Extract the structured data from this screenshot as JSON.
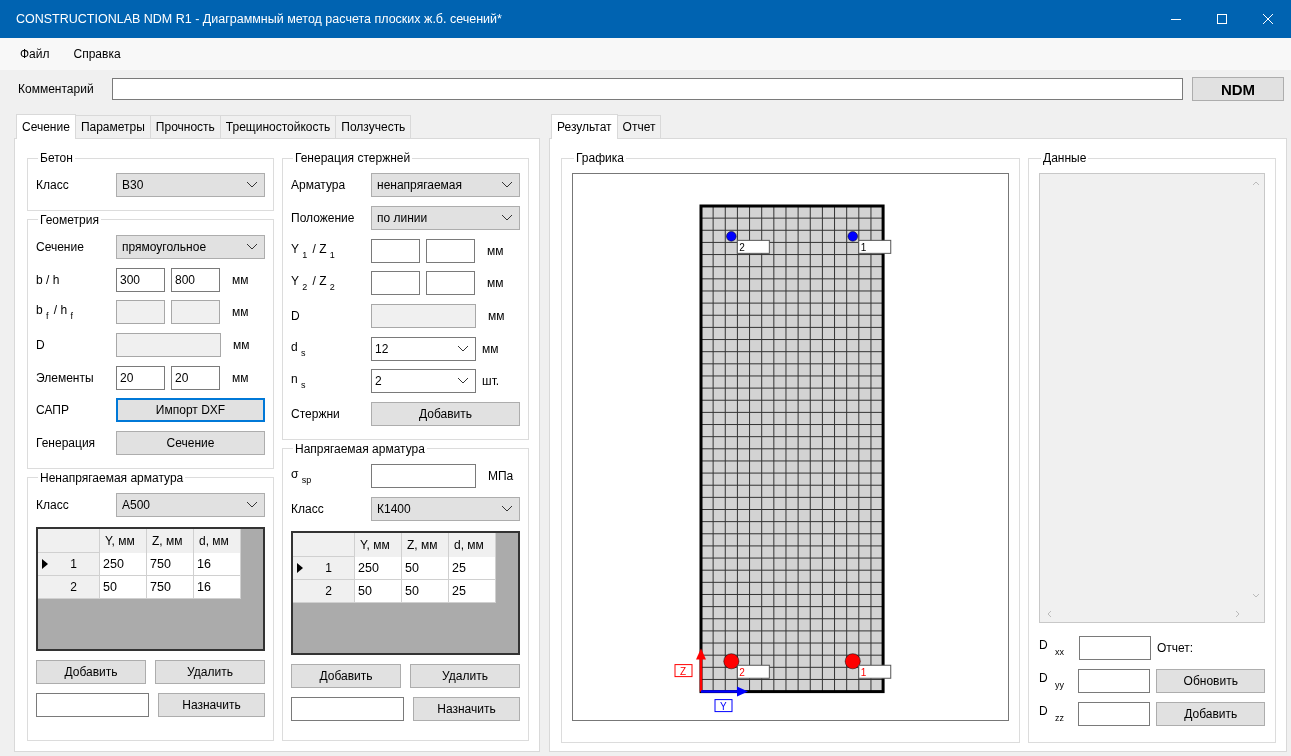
{
  "window": {
    "title": "CONSTRUCTIONLAB NDM R1 - Диаграммный метод расчета плоских ж.б. сечений*"
  },
  "menu": [
    "Файл",
    "Справка"
  ],
  "comment": {
    "label": "Комментарий",
    "button": "NDM"
  },
  "left_tabs": [
    {
      "label": "Сечение",
      "selected": true
    },
    {
      "label": "Параметры",
      "selected": false
    },
    {
      "label": "Прочность",
      "selected": false
    },
    {
      "label": "Трещиностойкость",
      "selected": false
    },
    {
      "label": "Ползучесть",
      "selected": false
    }
  ],
  "concrete": {
    "title": "Бетон",
    "rows": [
      {
        "kind": "select",
        "label": "Класс",
        "value": "В30"
      }
    ]
  },
  "geometry": {
    "title": "Геометрия",
    "rows": [
      {
        "kind": "select",
        "label": "Сечение",
        "value": "прямоугольное"
      },
      {
        "kind": "pair",
        "label": "b / h",
        "values": [
          "300",
          "800"
        ],
        "unit": "мм",
        "disabled": false
      },
      {
        "kind": "pair",
        "label": "b $_{f}$ / h $_{f}$",
        "unit": "мм",
        "disabled": true
      },
      {
        "kind": "single",
        "label": "D",
        "unit": "мм",
        "disabled": true
      },
      {
        "kind": "pair",
        "label": "Элементы",
        "values": [
          "20",
          "20"
        ],
        "unit": "мм",
        "disabled": false
      },
      {
        "kind": "button",
        "label": "САПР",
        "button": "Импорт DXF",
        "focused": true
      },
      {
        "kind": "button",
        "label": "Генерация",
        "button": "Сечение",
        "focused": false
      }
    ]
  },
  "generation": {
    "title": "Генерация стержней",
    "rows": [
      {
        "kind": "select",
        "label": "Арматура",
        "value": "ненапрягаемая"
      },
      {
        "kind": "select",
        "label": "Положение",
        "value": "по линии"
      },
      {
        "kind": "pair",
        "label": "Y $_{1}$ / Z $_{1}$",
        "unit": "мм",
        "disabled": false
      },
      {
        "kind": "pair",
        "label": "Y $_{2}$ / Z $_{2}$",
        "unit": "мм",
        "disabled": false
      },
      {
        "kind": "single",
        "label": "D",
        "unit": "мм",
        "disabled": true
      },
      {
        "kind": "combo",
        "label": "d $_{s}$",
        "value": "12",
        "unit": "мм"
      },
      {
        "kind": "combo",
        "label": "n $_{s}$",
        "value": "2",
        "unit": "шт."
      },
      {
        "kind": "button",
        "label": "Стержни",
        "button": "Добавить",
        "focused": false
      }
    ]
  },
  "nonprestressed": {
    "title": "Ненапрягаемая арматура",
    "rows": [
      {
        "kind": "select",
        "label": "Класс",
        "value": "А500"
      }
    ],
    "columns": [
      "Y, мм",
      "Z, мм",
      "d, мм"
    ],
    "table": [
      {
        "num": "1",
        "cells": [
          "250",
          "750",
          "16"
        ],
        "selected": true
      },
      {
        "num": "2",
        "cells": [
          "50",
          "750",
          "16"
        ],
        "selected": false
      }
    ],
    "buttons": [
      "Добавить",
      "Удалить"
    ],
    "assign": "Назначить"
  },
  "prestressed": {
    "title": "Напрягаемая арматура",
    "rows": [
      {
        "kind": "single",
        "label": "σ $_{sp}$",
        "unit": "МПа",
        "disabled": false
      },
      {
        "kind": "select",
        "label": "Класс",
        "value": "К1400"
      }
    ],
    "columns": [
      "Y, мм",
      "Z, мм",
      "d, мм"
    ],
    "table": [
      {
        "num": "1",
        "cells": [
          "250",
          "50",
          "25"
        ],
        "selected": true
      },
      {
        "num": "2",
        "cells": [
          "50",
          "50",
          "25"
        ],
        "selected": false
      }
    ],
    "buttons": [
      "Добавить",
      "Удалить"
    ],
    "assign": "Назначить"
  },
  "right_tabs": [
    {
      "label": "Результат",
      "selected": true
    },
    {
      "label": "Отчет",
      "selected": false
    }
  ],
  "graphics": {
    "title": "Графика",
    "axis_z": "Z",
    "axis_y": "Y",
    "nonprestressed_marker_labels": [
      "2",
      "1"
    ],
    "prestressed_marker_labels": [
      "2",
      "1"
    ]
  },
  "data": {
    "title": "Данные",
    "fields": [
      {
        "label": "D $_{xx}$"
      },
      {
        "label": "D $_{yy}$"
      },
      {
        "label": "D $_{zz}$"
      }
    ],
    "report_label": "Отчет:",
    "buttons": [
      "Обновить",
      "Добавить"
    ]
  }
}
